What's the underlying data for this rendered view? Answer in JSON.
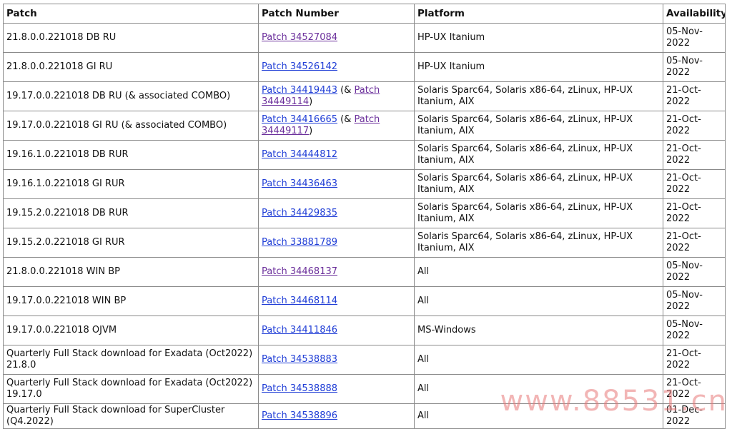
{
  "table": {
    "headers": {
      "patch": "Patch",
      "patch_number": "Patch Number",
      "platform": "Platform",
      "availability": "Availability"
    },
    "rows": [
      {
        "patch": "21.8.0.0.221018 DB RU",
        "link1": "Patch 34527084",
        "link1_visited": true,
        "platform": "HP-UX Itanium",
        "availability": "05-Nov-2022"
      },
      {
        "patch": "21.8.0.0.221018 GI RU",
        "link1": "Patch 34526142",
        "link1_visited": false,
        "platform": "HP-UX Itanium",
        "availability": "05-Nov-2022"
      },
      {
        "patch": "19.17.0.0.221018 DB RU (& associated COMBO)",
        "link1": "Patch 34419443",
        "link1_visited": false,
        "mid": " (& ",
        "link2": "Patch 34449114",
        "link2_visited": true,
        "tail": ")",
        "platform": "Solaris Sparc64, Solaris x86-64, zLinux, HP-UX Itanium, AIX",
        "availability": "21-Oct-2022"
      },
      {
        "patch": "19.17.0.0.221018 GI RU (& associated COMBO)",
        "link1": "Patch 34416665",
        "link1_visited": false,
        "mid": " (& ",
        "link2": "Patch 34449117",
        "link2_visited": true,
        "tail": ")",
        "platform": "Solaris Sparc64, Solaris x86-64, zLinux, HP-UX Itanium, AIX",
        "availability": "21-Oct-2022"
      },
      {
        "patch": "19.16.1.0.221018 DB RUR",
        "link1": "Patch 34444812",
        "link1_visited": false,
        "platform": "Solaris Sparc64, Solaris x86-64, zLinux, HP-UX Itanium, AIX",
        "availability": "21-Oct-2022"
      },
      {
        "patch": "19.16.1.0.221018 GI RUR",
        "link1": "Patch 34436463",
        "link1_visited": false,
        "platform": "Solaris Sparc64, Solaris x86-64, zLinux, HP-UX Itanium, AIX",
        "availability": "21-Oct-2022"
      },
      {
        "patch": "19.15.2.0.221018 DB RUR",
        "link1": "Patch 34429835",
        "link1_visited": false,
        "platform": "Solaris Sparc64, Solaris x86-64, zLinux, HP-UX Itanium, AIX",
        "availability": "21-Oct-2022"
      },
      {
        "patch": "19.15.2.0.221018 GI RUR",
        "link1": "Patch 33881789",
        "link1_visited": false,
        "platform": "Solaris Sparc64, Solaris x86-64, zLinux, HP-UX Itanium, AIX",
        "availability": "21-Oct-2022"
      },
      {
        "patch": "21.8.0.0.221018 WIN BP",
        "link1": "Patch 34468137",
        "link1_visited": true,
        "platform": "All",
        "availability": "05-Nov-2022"
      },
      {
        "patch": "19.17.0.0.221018 WIN BP",
        "link1": "Patch 34468114",
        "link1_visited": false,
        "platform": "All",
        "availability": "05-Nov-2022"
      },
      {
        "patch": "19.17.0.0.221018 OJVM",
        "link1": "Patch 34411846",
        "link1_visited": false,
        "platform": "MS-Windows",
        "availability": "05-Nov-2022"
      },
      {
        "patch": "Quarterly Full Stack download for Exadata (Oct2022) 21.8.0",
        "link1": "Patch 34538883",
        "link1_visited": false,
        "platform": "All",
        "availability": "21-Oct-2022"
      },
      {
        "patch": "Quarterly Full Stack download for Exadata (Oct2022) 19.17.0",
        "link1": "Patch 34538888",
        "link1_visited": false,
        "platform": "All",
        "availability": "21-Oct-2022"
      },
      {
        "patch": "Quarterly Full Stack download for SuperCluster (Q4.2022)",
        "link1": "Patch 34538896",
        "link1_visited": false,
        "platform": "All",
        "availability": "01-Dec-2022"
      }
    ]
  },
  "colors": {
    "link": "#1f3dd6",
    "visited_link": "#6b2f9b",
    "border": "#8a8a8a",
    "watermark": "#e87878"
  },
  "watermark": {
    "text": "www.88531.cn"
  }
}
